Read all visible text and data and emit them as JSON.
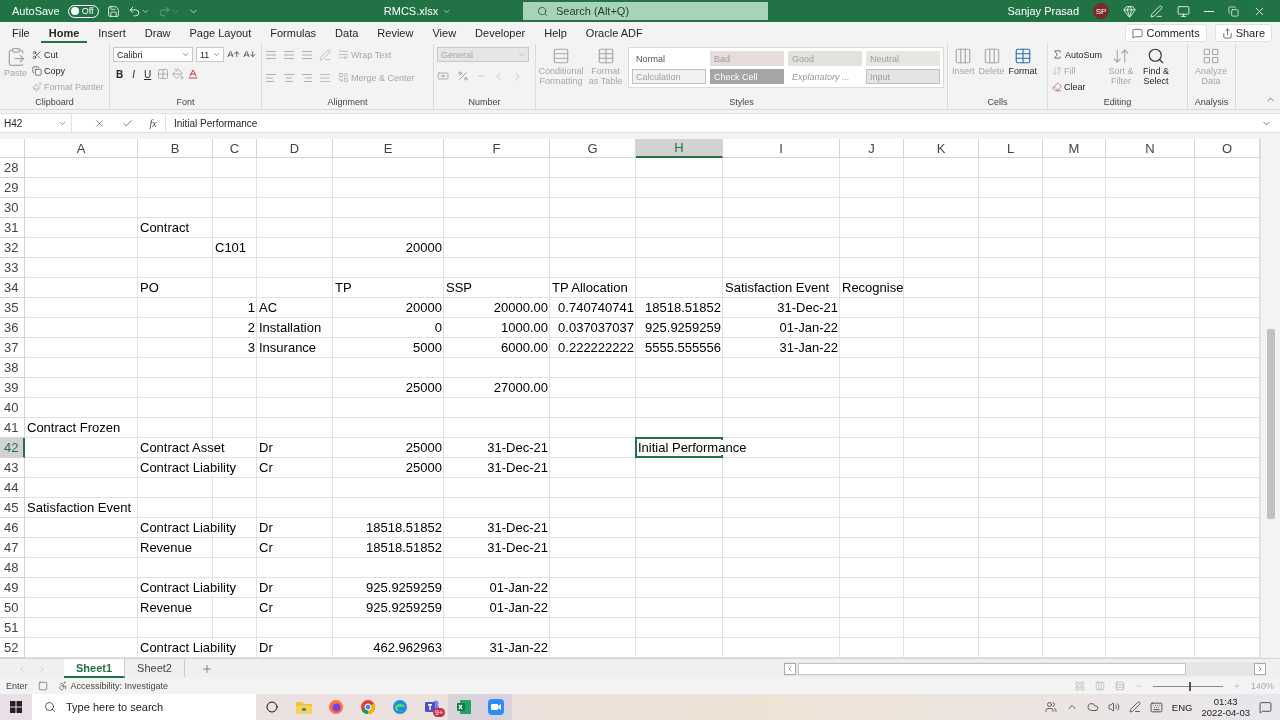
{
  "title_bar": {
    "autosave_label": "AutoSave",
    "autosave": {
      "on": false,
      "label": "Off"
    },
    "redo_disabled": true,
    "file_name": "RMCS.xlsx",
    "search_placeholder": "Search (Alt+Q)",
    "user_name": "Sanjay Prasad",
    "user_initials": "SP"
  },
  "menu_tabs": [
    {
      "label": "File",
      "selected": false
    },
    {
      "label": "Home",
      "selected": true
    },
    {
      "label": "Insert",
      "selected": false
    },
    {
      "label": "Draw",
      "selected": false
    },
    {
      "label": "Page Layout",
      "selected": false
    },
    {
      "label": "Formulas",
      "selected": false
    },
    {
      "label": "Data",
      "selected": false
    },
    {
      "label": "Review",
      "selected": false
    },
    {
      "label": "View",
      "selected": false
    },
    {
      "label": "Developer",
      "selected": false
    },
    {
      "label": "Help",
      "selected": false
    },
    {
      "label": "Oracle ADF",
      "selected": false
    }
  ],
  "header_buttons": [
    {
      "kind": "comments",
      "label": "Comments"
    },
    {
      "kind": "share",
      "label": "Share"
    }
  ],
  "ribbon": {
    "groups": [
      {
        "kind": "clipboard",
        "label": "Clipboard",
        "buttons": [
          {
            "label": "Paste",
            "disabled": true
          },
          {
            "label": "Cut",
            "disabled": false
          },
          {
            "label": "Copy",
            "disabled": false
          },
          {
            "label": "Format Painter",
            "disabled": true
          }
        ]
      },
      {
        "kind": "font",
        "label": "Font",
        "font_name": "Calibri",
        "font_size": "11",
        "bold": "B",
        "italic": "I",
        "underline": "U"
      },
      {
        "kind": "alignment",
        "label": "Alignment",
        "buttons": [
          {
            "label": "Wrap Text",
            "disabled": true
          },
          {
            "label": "Merge & Center",
            "disabled": true
          }
        ]
      },
      {
        "kind": "number",
        "label": "Number",
        "format": {
          "value": "General",
          "disabled": true
        }
      },
      {
        "kind": "styles",
        "label": "Styles",
        "buttons": [
          {
            "label": "Conditional Formatting",
            "disabled": true
          },
          {
            "label": "Format as Table",
            "disabled": true
          }
        ],
        "gallery": [
          {
            "label": "Normal",
            "kind": "normal"
          },
          {
            "label": "Bad",
            "kind": "bad"
          },
          {
            "label": "Good",
            "kind": "good"
          },
          {
            "label": "Neutral",
            "kind": "neutral"
          },
          {
            "label": "Calculation",
            "kind": "calculation"
          },
          {
            "label": "Check Cell",
            "kind": "check"
          },
          {
            "label": "Explanatory ...",
            "kind": "explanatory"
          },
          {
            "label": "Input",
            "kind": "input"
          }
        ]
      },
      {
        "kind": "cells",
        "label": "Cells",
        "buttons": [
          {
            "label": "Insert",
            "disabled": true
          },
          {
            "label": "Delete",
            "disabled": true
          },
          {
            "label": "Format",
            "disabled": false
          }
        ]
      },
      {
        "kind": "editing",
        "label": "Editing",
        "buttons": [
          {
            "label": "AutoSum",
            "disabled": false
          },
          {
            "label": "Fill",
            "disabled": true
          },
          {
            "label": "Clear",
            "disabled": false
          },
          {
            "label": "Sort & Filter",
            "disabled": true
          },
          {
            "label": "Find & Select",
            "disabled": false
          }
        ]
      },
      {
        "kind": "analysis",
        "label": "Analysis",
        "buttons": [
          {
            "label": "Analyze Data",
            "disabled": true
          }
        ]
      }
    ]
  },
  "formula_bar": {
    "name_box": "H42",
    "function_label": "fx",
    "formula": "Initial Performance"
  },
  "grid": {
    "columns": [
      {
        "label": "A",
        "selected": false
      },
      {
        "label": "B",
        "selected": false
      },
      {
        "label": "C",
        "selected": false
      },
      {
        "label": "D",
        "selected": false
      },
      {
        "label": "E",
        "selected": false
      },
      {
        "label": "F",
        "selected": false
      },
      {
        "label": "G",
        "selected": false
      },
      {
        "label": "H",
        "selected": true
      },
      {
        "label": "I",
        "selected": false
      },
      {
        "label": "J",
        "selected": false
      },
      {
        "label": "K",
        "selected": false
      },
      {
        "label": "L",
        "selected": false
      },
      {
        "label": "M",
        "selected": false
      },
      {
        "label": "N",
        "selected": false
      },
      {
        "label": "O",
        "selected": false
      }
    ],
    "rows": [
      {
        "number": "28",
        "selected": false,
        "cells": []
      },
      {
        "number": "29",
        "selected": false,
        "cells": []
      },
      {
        "number": "30",
        "selected": false,
        "cells": []
      },
      {
        "number": "31",
        "selected": false,
        "cells": [
          null,
          {
            "text": "Contract",
            "kind": "text"
          }
        ]
      },
      {
        "number": "32",
        "selected": false,
        "cells": [
          null,
          null,
          {
            "text": "C101",
            "kind": "text"
          },
          null,
          {
            "text": "20000",
            "kind": "number"
          }
        ]
      },
      {
        "number": "33",
        "selected": false,
        "cells": []
      },
      {
        "number": "34",
        "selected": false,
        "cells": [
          null,
          {
            "text": "PO",
            "kind": "text"
          },
          null,
          null,
          {
            "text": "TP",
            "kind": "text"
          },
          {
            "text": "SSP",
            "kind": "text"
          },
          {
            "text": "TP Allocation",
            "kind": "text"
          },
          null,
          {
            "text": "Satisfaction Event",
            "kind": "text"
          },
          {
            "text": "Recognise",
            "kind": "text"
          }
        ]
      },
      {
        "number": "35",
        "selected": false,
        "cells": [
          null,
          null,
          {
            "text": "1",
            "kind": "number"
          },
          {
            "text": "AC",
            "kind": "text"
          },
          {
            "text": "20000",
            "kind": "number"
          },
          {
            "text": "20000.00",
            "kind": "number"
          },
          {
            "text": "0.740740741",
            "kind": "number"
          },
          {
            "text": "18518.51852",
            "kind": "number"
          },
          {
            "text": "31-Dec-21",
            "kind": "number"
          }
        ]
      },
      {
        "number": "36",
        "selected": false,
        "cells": [
          null,
          null,
          {
            "text": "2",
            "kind": "number"
          },
          {
            "text": "Installation",
            "kind": "text"
          },
          {
            "text": "0",
            "kind": "number"
          },
          {
            "text": "1000.00",
            "kind": "number"
          },
          {
            "text": "0.037037037",
            "kind": "number"
          },
          {
            "text": "925.9259259",
            "kind": "number"
          },
          {
            "text": "01-Jan-22",
            "kind": "number"
          }
        ]
      },
      {
        "number": "37",
        "selected": false,
        "cells": [
          null,
          null,
          {
            "text": "3",
            "kind": "number"
          },
          {
            "text": "Insurance",
            "kind": "text"
          },
          {
            "text": "5000",
            "kind": "number"
          },
          {
            "text": "6000.00",
            "kind": "number"
          },
          {
            "text": "0.222222222",
            "kind": "number"
          },
          {
            "text": "5555.555556",
            "kind": "number"
          },
          {
            "text": "31-Jan-22",
            "kind": "number"
          }
        ]
      },
      {
        "number": "38",
        "selected": false,
        "cells": []
      },
      {
        "number": "39",
        "selected": false,
        "cells": [
          null,
          null,
          null,
          null,
          {
            "text": "25000",
            "kind": "number"
          },
          {
            "text": "27000.00",
            "kind": "number"
          }
        ]
      },
      {
        "number": "40",
        "selected": false,
        "cells": []
      },
      {
        "number": "41",
        "selected": false,
        "cells": [
          {
            "text": "Contract Frozen",
            "kind": "text"
          }
        ]
      },
      {
        "number": "42",
        "selected": true,
        "cells": [
          null,
          {
            "text": "Contract Asset",
            "kind": "text"
          },
          null,
          {
            "text": "Dr",
            "kind": "text"
          },
          {
            "text": "25000",
            "kind": "number"
          },
          {
            "text": "31-Dec-21",
            "kind": "number"
          },
          null,
          {
            "text": "Initial Performance",
            "kind": "text"
          }
        ]
      },
      {
        "number": "43",
        "selected": false,
        "cells": [
          null,
          {
            "text": "Contract Liability",
            "kind": "text"
          },
          null,
          {
            "text": "Cr",
            "kind": "text"
          },
          {
            "text": "25000",
            "kind": "number"
          },
          {
            "text": "31-Dec-21",
            "kind": "number"
          }
        ]
      },
      {
        "number": "44",
        "selected": false,
        "cells": []
      },
      {
        "number": "45",
        "selected": false,
        "cells": [
          {
            "text": "Satisfaction Event",
            "kind": "text"
          }
        ]
      },
      {
        "number": "46",
        "selected": false,
        "cells": [
          null,
          {
            "text": "Contract Liability",
            "kind": "text"
          },
          null,
          {
            "text": "Dr",
            "kind": "text"
          },
          {
            "text": "18518.51852",
            "kind": "number"
          },
          {
            "text": "31-Dec-21",
            "kind": "number"
          }
        ]
      },
      {
        "number": "47",
        "selected": false,
        "cells": [
          null,
          {
            "text": "Revenue",
            "kind": "text"
          },
          null,
          {
            "text": "Cr",
            "kind": "text"
          },
          {
            "text": "18518.51852",
            "kind": "number"
          },
          {
            "text": "31-Dec-21",
            "kind": "number"
          }
        ]
      },
      {
        "number": "48",
        "selected": false,
        "cells": []
      },
      {
        "number": "49",
        "selected": false,
        "cells": [
          null,
          {
            "text": "Contract Liability",
            "kind": "text"
          },
          null,
          {
            "text": "Dr",
            "kind": "text"
          },
          {
            "text": "925.9259259",
            "kind": "number"
          },
          {
            "text": "01-Jan-22",
            "kind": "number"
          }
        ]
      },
      {
        "number": "50",
        "selected": false,
        "cells": [
          null,
          {
            "text": "Revenue",
            "kind": "text"
          },
          null,
          {
            "text": "Cr",
            "kind": "text"
          },
          {
            "text": "925.9259259",
            "kind": "number"
          },
          {
            "text": "01-Jan-22",
            "kind": "number"
          }
        ]
      },
      {
        "number": "51",
        "selected": false,
        "cells": []
      },
      {
        "number": "52",
        "selected": false,
        "cells": [
          null,
          {
            "text": "Contract Liability",
            "kind": "text"
          },
          null,
          {
            "text": "Dr",
            "kind": "text"
          },
          {
            "text": "462.962963",
            "kind": "number"
          },
          {
            "text": "31-Jan-22",
            "kind": "number"
          }
        ]
      }
    ]
  },
  "sheet_tabs": [
    {
      "label": "Sheet1",
      "selected": true
    },
    {
      "label": "Sheet2",
      "selected": false
    }
  ],
  "status_bar": {
    "mode": "Enter",
    "accessibility": "Accessibility: Investigate",
    "zoom": {
      "level": 0.52,
      "reading": "140%"
    }
  },
  "taskbar": {
    "search_placeholder": "Type here to search",
    "apps": [
      {
        "kind": "explorer",
        "active": false
      },
      {
        "kind": "firefox",
        "active": false
      },
      {
        "kind": "chrome",
        "active": false
      },
      {
        "kind": "edge",
        "active": false
      },
      {
        "kind": "teams",
        "active": false,
        "badge": "9+"
      },
      {
        "kind": "excel",
        "active": true
      },
      {
        "kind": "zoom",
        "active": true
      }
    ],
    "language": "ENG",
    "time": "01:43",
    "date": "2022-04-03"
  }
}
